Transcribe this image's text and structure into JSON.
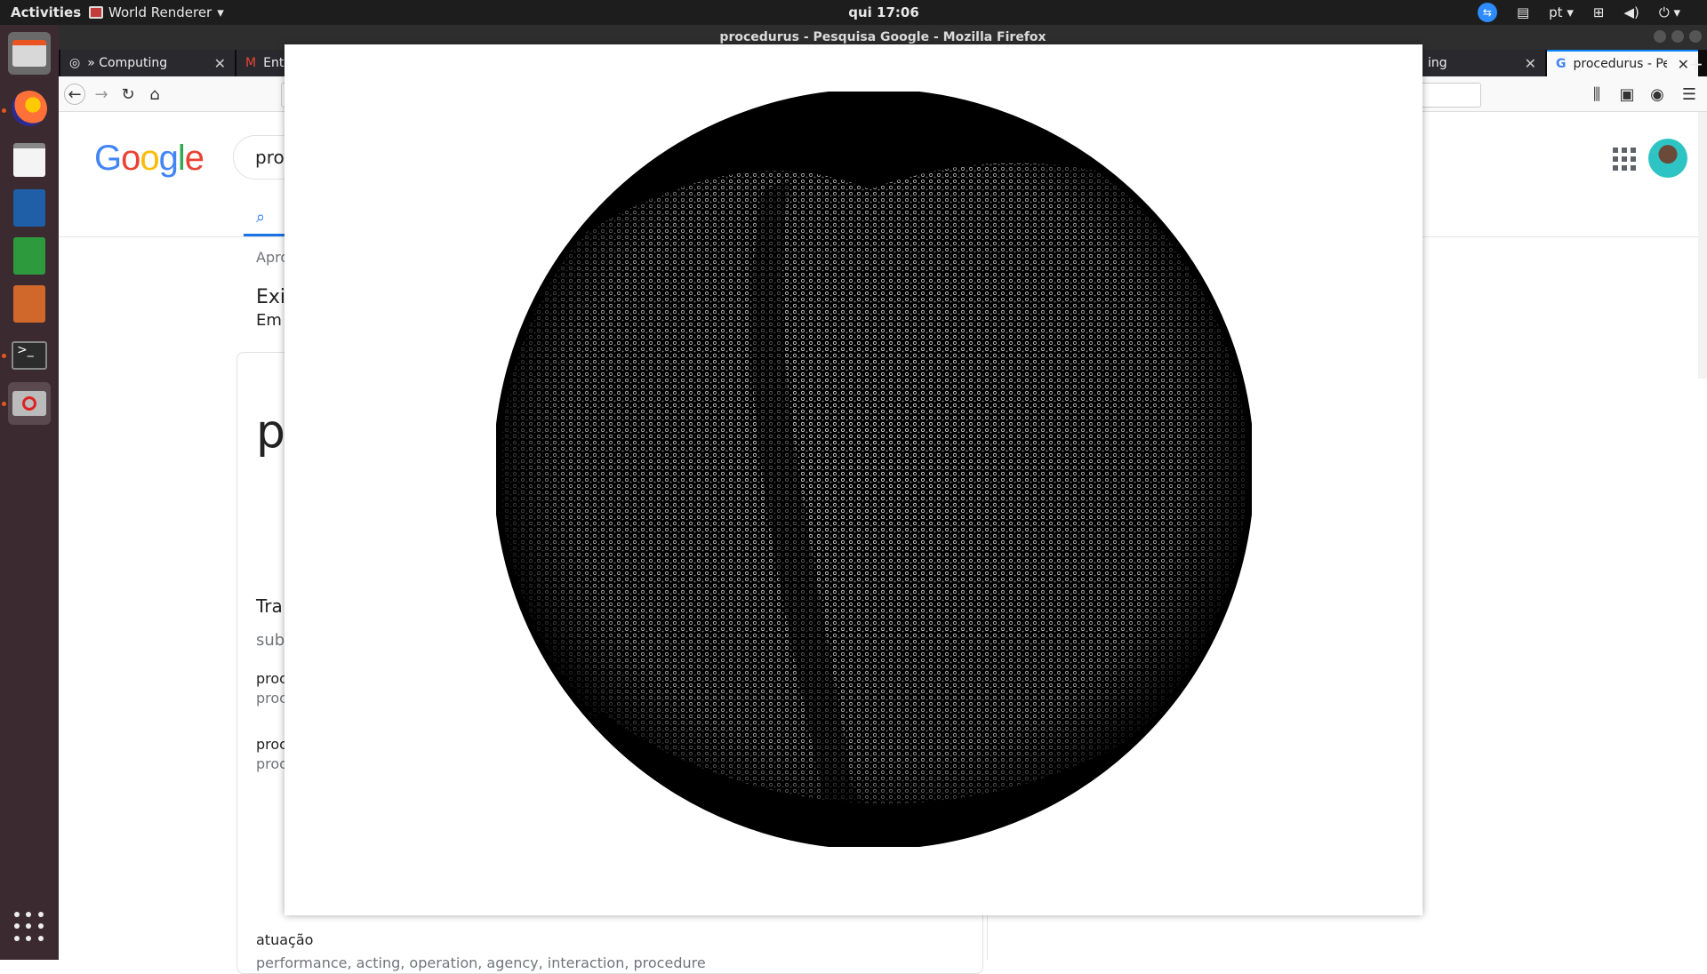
{
  "topbar": {
    "activities": "Activities",
    "app_name": "World Renderer",
    "clock": "qui 17:06",
    "keyboard": "pt"
  },
  "firefox": {
    "window_title": "procedurus - Pesquisa Google - Mozilla Firefox",
    "tabs": [
      {
        "label": "» Computing"
      },
      {
        "label": "Ent"
      },
      {
        "label": "ing"
      },
      {
        "label": "procedurus - Pesquis"
      }
    ]
  },
  "google": {
    "query": "pro",
    "stats": "Apro",
    "show_label": "Exi",
    "in_label": "Em",
    "big_word": "p",
    "translations_title": "Tra",
    "sub_label": "sub",
    "words": [
      {
        "word": "proc",
        "synonyms": "proc"
      },
      {
        "word": "proc",
        "synonyms": "proc"
      },
      {
        "word": "atuação",
        "synonyms": "performance, acting, operation, agency, interaction, procedure"
      }
    ]
  },
  "renderer": {
    "background_color": "#ffffff",
    "globe_color": "#000000",
    "mesh_color": "#ffffff"
  },
  "colors": {
    "topbar": "#1d1d1d",
    "dock": "#3b2b30",
    "accent": "#e95420"
  }
}
